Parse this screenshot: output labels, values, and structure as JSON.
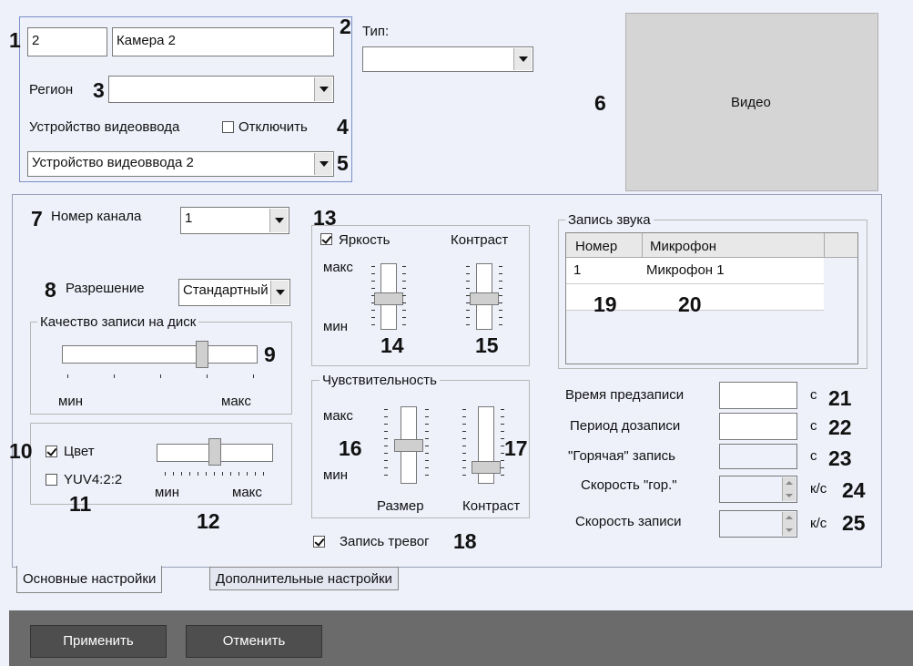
{
  "header": {
    "id_value": "2",
    "name_value": "Камера 2",
    "type_label": "Тип:",
    "type_value": "",
    "region_label": "Регион",
    "region_value": "",
    "video_device_label": "Устройство видеоввода",
    "disable_label": "Отключить",
    "disable_checked": false,
    "video_device_value": "Устройство видеоввода 2",
    "video_label": "Видео"
  },
  "channel": {
    "label": "Номер канала",
    "value": "1"
  },
  "resolution": {
    "label": "Разрешение",
    "value": "Стандартный"
  },
  "disk_quality": {
    "legend": "Качество записи на диск",
    "min_label": "мин",
    "max_label": "макс",
    "level": 0.73
  },
  "color": {
    "label": "Цвет",
    "checked": true,
    "yuv_label": "YUV4:2:2",
    "yuv_checked": false,
    "min_label": "мин",
    "max_label": "макс",
    "level": 0.5
  },
  "brightness": {
    "label": "Яркость",
    "checked": true,
    "contrast_label": "Контраст",
    "max_label": "макс",
    "min_label": "мин",
    "brightness_level": 0.45,
    "contrast_level": 0.45
  },
  "sensitivity": {
    "legend": "Чувствительность",
    "max_label": "макс",
    "min_label": "мин",
    "size_label": "Размер",
    "contrast_label": "Контраст",
    "size_level": 0.5,
    "contrast_level": 0.15
  },
  "alarm_record": {
    "label": "Запись тревог",
    "checked": true
  },
  "audio": {
    "legend": "Запись звука",
    "columns": [
      "Номер",
      "Микрофон"
    ],
    "rows": [
      [
        "1",
        "Микрофон 1"
      ]
    ]
  },
  "timing": {
    "prerecord_label": "Время предзаписи",
    "prerecord_value": "",
    "prerecord_unit": "с",
    "postrecord_label": "Период дозаписи",
    "postrecord_value": "",
    "postrecord_unit": "с",
    "hot_label": "\"Горячая\" запись",
    "hot_value": "",
    "hot_unit": "с",
    "hot_speed_label": "Скорость \"гор.\"",
    "hot_speed_value": "",
    "hot_speed_unit": "к/с",
    "rec_speed_label": "Скорость записи",
    "rec_speed_value": "",
    "rec_speed_unit": "к/с"
  },
  "tabs": [
    "Основные настройки",
    "Дополнительные настройки"
  ],
  "buttons": {
    "apply": "Применить",
    "cancel": "Отменить"
  },
  "callouts": [
    "1",
    "2",
    "3",
    "4",
    "5",
    "6",
    "7",
    "8",
    "9",
    "10",
    "11",
    "12",
    "13",
    "14",
    "15",
    "16",
    "17",
    "18",
    "19",
    "20",
    "21",
    "22",
    "23",
    "24",
    "25"
  ]
}
